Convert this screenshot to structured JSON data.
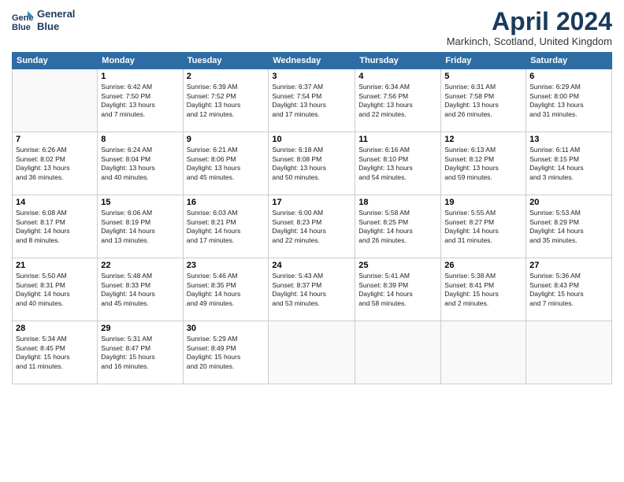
{
  "logo": {
    "line1": "General",
    "line2": "Blue"
  },
  "title": "April 2024",
  "location": "Markinch, Scotland, United Kingdom",
  "days_header": [
    "Sunday",
    "Monday",
    "Tuesday",
    "Wednesday",
    "Thursday",
    "Friday",
    "Saturday"
  ],
  "weeks": [
    [
      {
        "num": "",
        "info": ""
      },
      {
        "num": "1",
        "info": "Sunrise: 6:42 AM\nSunset: 7:50 PM\nDaylight: 13 hours\nand 7 minutes."
      },
      {
        "num": "2",
        "info": "Sunrise: 6:39 AM\nSunset: 7:52 PM\nDaylight: 13 hours\nand 12 minutes."
      },
      {
        "num": "3",
        "info": "Sunrise: 6:37 AM\nSunset: 7:54 PM\nDaylight: 13 hours\nand 17 minutes."
      },
      {
        "num": "4",
        "info": "Sunrise: 6:34 AM\nSunset: 7:56 PM\nDaylight: 13 hours\nand 22 minutes."
      },
      {
        "num": "5",
        "info": "Sunrise: 6:31 AM\nSunset: 7:58 PM\nDaylight: 13 hours\nand 26 minutes."
      },
      {
        "num": "6",
        "info": "Sunrise: 6:29 AM\nSunset: 8:00 PM\nDaylight: 13 hours\nand 31 minutes."
      }
    ],
    [
      {
        "num": "7",
        "info": "Sunrise: 6:26 AM\nSunset: 8:02 PM\nDaylight: 13 hours\nand 36 minutes."
      },
      {
        "num": "8",
        "info": "Sunrise: 6:24 AM\nSunset: 8:04 PM\nDaylight: 13 hours\nand 40 minutes."
      },
      {
        "num": "9",
        "info": "Sunrise: 6:21 AM\nSunset: 8:06 PM\nDaylight: 13 hours\nand 45 minutes."
      },
      {
        "num": "10",
        "info": "Sunrise: 6:18 AM\nSunset: 8:08 PM\nDaylight: 13 hours\nand 50 minutes."
      },
      {
        "num": "11",
        "info": "Sunrise: 6:16 AM\nSunset: 8:10 PM\nDaylight: 13 hours\nand 54 minutes."
      },
      {
        "num": "12",
        "info": "Sunrise: 6:13 AM\nSunset: 8:12 PM\nDaylight: 13 hours\nand 59 minutes."
      },
      {
        "num": "13",
        "info": "Sunrise: 6:11 AM\nSunset: 8:15 PM\nDaylight: 14 hours\nand 3 minutes."
      }
    ],
    [
      {
        "num": "14",
        "info": "Sunrise: 6:08 AM\nSunset: 8:17 PM\nDaylight: 14 hours\nand 8 minutes."
      },
      {
        "num": "15",
        "info": "Sunrise: 6:06 AM\nSunset: 8:19 PM\nDaylight: 14 hours\nand 13 minutes."
      },
      {
        "num": "16",
        "info": "Sunrise: 6:03 AM\nSunset: 8:21 PM\nDaylight: 14 hours\nand 17 minutes."
      },
      {
        "num": "17",
        "info": "Sunrise: 6:00 AM\nSunset: 8:23 PM\nDaylight: 14 hours\nand 22 minutes."
      },
      {
        "num": "18",
        "info": "Sunrise: 5:58 AM\nSunset: 8:25 PM\nDaylight: 14 hours\nand 26 minutes."
      },
      {
        "num": "19",
        "info": "Sunrise: 5:55 AM\nSunset: 8:27 PM\nDaylight: 14 hours\nand 31 minutes."
      },
      {
        "num": "20",
        "info": "Sunrise: 5:53 AM\nSunset: 8:29 PM\nDaylight: 14 hours\nand 35 minutes."
      }
    ],
    [
      {
        "num": "21",
        "info": "Sunrise: 5:50 AM\nSunset: 8:31 PM\nDaylight: 14 hours\nand 40 minutes."
      },
      {
        "num": "22",
        "info": "Sunrise: 5:48 AM\nSunset: 8:33 PM\nDaylight: 14 hours\nand 45 minutes."
      },
      {
        "num": "23",
        "info": "Sunrise: 5:46 AM\nSunset: 8:35 PM\nDaylight: 14 hours\nand 49 minutes."
      },
      {
        "num": "24",
        "info": "Sunrise: 5:43 AM\nSunset: 8:37 PM\nDaylight: 14 hours\nand 53 minutes."
      },
      {
        "num": "25",
        "info": "Sunrise: 5:41 AM\nSunset: 8:39 PM\nDaylight: 14 hours\nand 58 minutes."
      },
      {
        "num": "26",
        "info": "Sunrise: 5:38 AM\nSunset: 8:41 PM\nDaylight: 15 hours\nand 2 minutes."
      },
      {
        "num": "27",
        "info": "Sunrise: 5:36 AM\nSunset: 8:43 PM\nDaylight: 15 hours\nand 7 minutes."
      }
    ],
    [
      {
        "num": "28",
        "info": "Sunrise: 5:34 AM\nSunset: 8:45 PM\nDaylight: 15 hours\nand 11 minutes."
      },
      {
        "num": "29",
        "info": "Sunrise: 5:31 AM\nSunset: 8:47 PM\nDaylight: 15 hours\nand 16 minutes."
      },
      {
        "num": "30",
        "info": "Sunrise: 5:29 AM\nSunset: 8:49 PM\nDaylight: 15 hours\nand 20 minutes."
      },
      {
        "num": "",
        "info": ""
      },
      {
        "num": "",
        "info": ""
      },
      {
        "num": "",
        "info": ""
      },
      {
        "num": "",
        "info": ""
      }
    ]
  ]
}
